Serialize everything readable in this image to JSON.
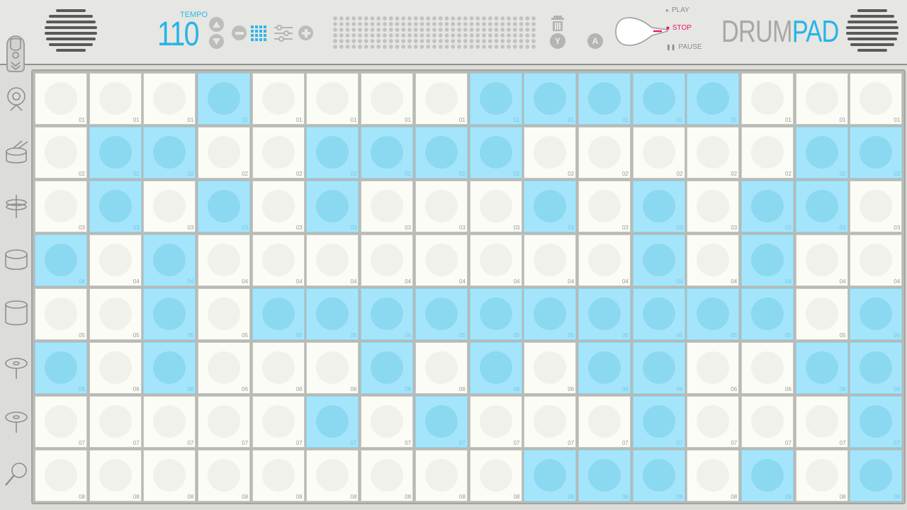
{
  "app": {
    "brand_part1": "DRUM",
    "brand_part2": "PAD"
  },
  "tempo": {
    "label": "TEMPO",
    "value": "110"
  },
  "controls": {
    "tempo_up_icon": "triangle-up-icon",
    "tempo_down_icon": "triangle-down-icon",
    "minus_icon": "minus-circle-icon",
    "grid_icon": "grid-icon",
    "mixer_icon": "sliders-icon",
    "plus_icon": "plus-circle-icon",
    "delete_icon": "trash-icon",
    "y_label": "Y",
    "a_label": "A"
  },
  "transport": {
    "play": "PLAY",
    "stop": "STOP",
    "pause": "PAUSE",
    "active": "stop"
  },
  "colors": {
    "accent": "#27b3e8",
    "pad_on": "#a5e5fb",
    "pad_off": "#fcfcf7",
    "stop_active": "#e8186f"
  },
  "instruments": [
    {
      "icon": "cymbal-stand-icon"
    },
    {
      "icon": "snare-drum-icon"
    },
    {
      "icon": "hihat-icon"
    },
    {
      "icon": "tom-drum-icon"
    },
    {
      "icon": "floor-tom-icon"
    },
    {
      "icon": "ride-cymbal-icon"
    },
    {
      "icon": "crash-cymbal-icon"
    },
    {
      "icon": "maraca-icon"
    }
  ],
  "rows": [
    {
      "label": "01",
      "steps": [
        0,
        0,
        0,
        1,
        0,
        0,
        0,
        0,
        1,
        1,
        1,
        1,
        1,
        0,
        0,
        0
      ]
    },
    {
      "label": "02",
      "steps": [
        0,
        1,
        1,
        0,
        0,
        1,
        1,
        1,
        1,
        0,
        0,
        0,
        0,
        0,
        1,
        1
      ]
    },
    {
      "label": "03",
      "steps": [
        0,
        1,
        0,
        1,
        0,
        1,
        0,
        0,
        0,
        1,
        0,
        1,
        0,
        1,
        1,
        0
      ]
    },
    {
      "label": "04",
      "steps": [
        1,
        0,
        1,
        0,
        0,
        0,
        0,
        0,
        0,
        0,
        0,
        1,
        0,
        1,
        0,
        0
      ]
    },
    {
      "label": "05",
      "steps": [
        0,
        0,
        1,
        0,
        1,
        1,
        1,
        1,
        1,
        1,
        1,
        1,
        1,
        1,
        0,
        1
      ]
    },
    {
      "label": "06",
      "steps": [
        1,
        0,
        1,
        0,
        0,
        0,
        1,
        0,
        1,
        0,
        1,
        1,
        0,
        0,
        1,
        1
      ]
    },
    {
      "label": "07",
      "steps": [
        0,
        0,
        0,
        0,
        0,
        1,
        0,
        1,
        0,
        0,
        0,
        1,
        0,
        0,
        0,
        1
      ]
    },
    {
      "label": "08",
      "steps": [
        0,
        0,
        0,
        0,
        0,
        0,
        0,
        0,
        0,
        1,
        1,
        1,
        0,
        1,
        0,
        1
      ]
    }
  ]
}
